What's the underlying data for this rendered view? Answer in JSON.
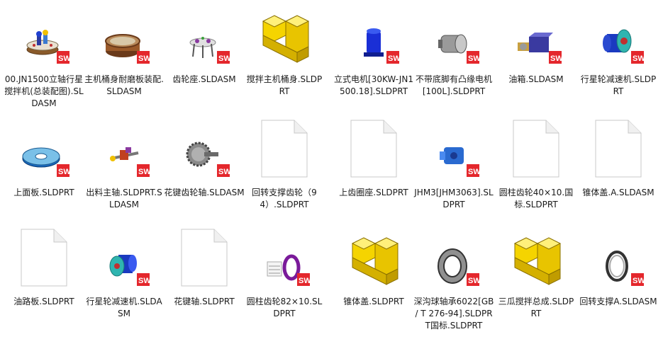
{
  "files": [
    {
      "label": "00.JN1500立轴行星搅拌机(总装配图).SLDASM",
      "icon": "assembly-stand-icon",
      "badge": "SW"
    },
    {
      "label": "主机桶身耐磨板装配.SLDASM",
      "icon": "drum-assembly-icon",
      "badge": "SW"
    },
    {
      "label": "齿轮座.SLDASM",
      "icon": "gear-seat-icon",
      "badge": "SW"
    },
    {
      "label": "搅拌主机桶身.SLDPRT",
      "icon": "part-generic-icon",
      "badge": ""
    },
    {
      "label": "立式电机[30KW-JN1500.18].SLDPRT",
      "icon": "vertical-motor-icon",
      "badge": "SW"
    },
    {
      "label": "不带底脚有凸缘电机[100L].SLDPRT",
      "icon": "flange-motor-icon",
      "badge": "SW"
    },
    {
      "label": "油箱.SLDASM",
      "icon": "oil-tank-icon",
      "badge": "SW"
    },
    {
      "label": "行星轮减速机.SLDPRT",
      "icon": "planetary-reducer-icon",
      "badge": "SW"
    },
    {
      "label": "上面板.SLDPRT",
      "icon": "top-plate-icon",
      "badge": "SW"
    },
    {
      "label": "出料主轴.SLDPRT.SLDASM",
      "icon": "discharge-shaft-icon",
      "badge": "SW"
    },
    {
      "label": "花键齿轮轴.SLDASM",
      "icon": "spline-gear-shaft-icon",
      "badge": "SW"
    },
    {
      "label": "回转支撑齿轮（94）.SLDPRT",
      "icon": "blank-file-icon",
      "badge": ""
    },
    {
      "label": "上齿圈座.SLDPRT",
      "icon": "blank-file-icon",
      "badge": ""
    },
    {
      "label": "JHM3[JHM3063].SLDPRT",
      "icon": "hydraulic-pump-icon",
      "badge": "SW"
    },
    {
      "label": "圆柱齿轮40×10.国标.SLDPRT",
      "icon": "blank-file-icon",
      "badge": ""
    },
    {
      "label": "锥体盖.A.SLDASM",
      "icon": "blank-file-icon",
      "badge": ""
    },
    {
      "label": "油路板.SLDPRT",
      "icon": "blank-file-icon",
      "badge": ""
    },
    {
      "label": "行星轮减速机.SLDASM",
      "icon": "planetary-reducer-asm-icon",
      "badge": "SW"
    },
    {
      "label": "花键轴.SLDPRT",
      "icon": "blank-file-icon",
      "badge": ""
    },
    {
      "label": "圆柱齿轮82×10.SLDPRT",
      "icon": "ring-gear-icon",
      "badge": "SW"
    },
    {
      "label": "锥体盖.SLDPRT",
      "icon": "part-generic-icon",
      "badge": ""
    },
    {
      "label": "深沟球轴承6022[GB / T 276-94].SLDPRT国标.SLDPRT",
      "icon": "ball-bearing-icon",
      "badge": "SW"
    },
    {
      "label": "三瓜搅拌总成.SLDPRT",
      "icon": "part-generic-icon",
      "badge": ""
    },
    {
      "label": "回转支撑A.SLDASM",
      "icon": "slewing-ring-icon",
      "badge": "SW"
    }
  ],
  "colors": {
    "sw_badge": "#e4272c",
    "part_yellow": "#f5d400",
    "part_outline": "#b89400",
    "motor_blue": "#1a2fd6",
    "reducer_teal": "#2fb5b0"
  }
}
